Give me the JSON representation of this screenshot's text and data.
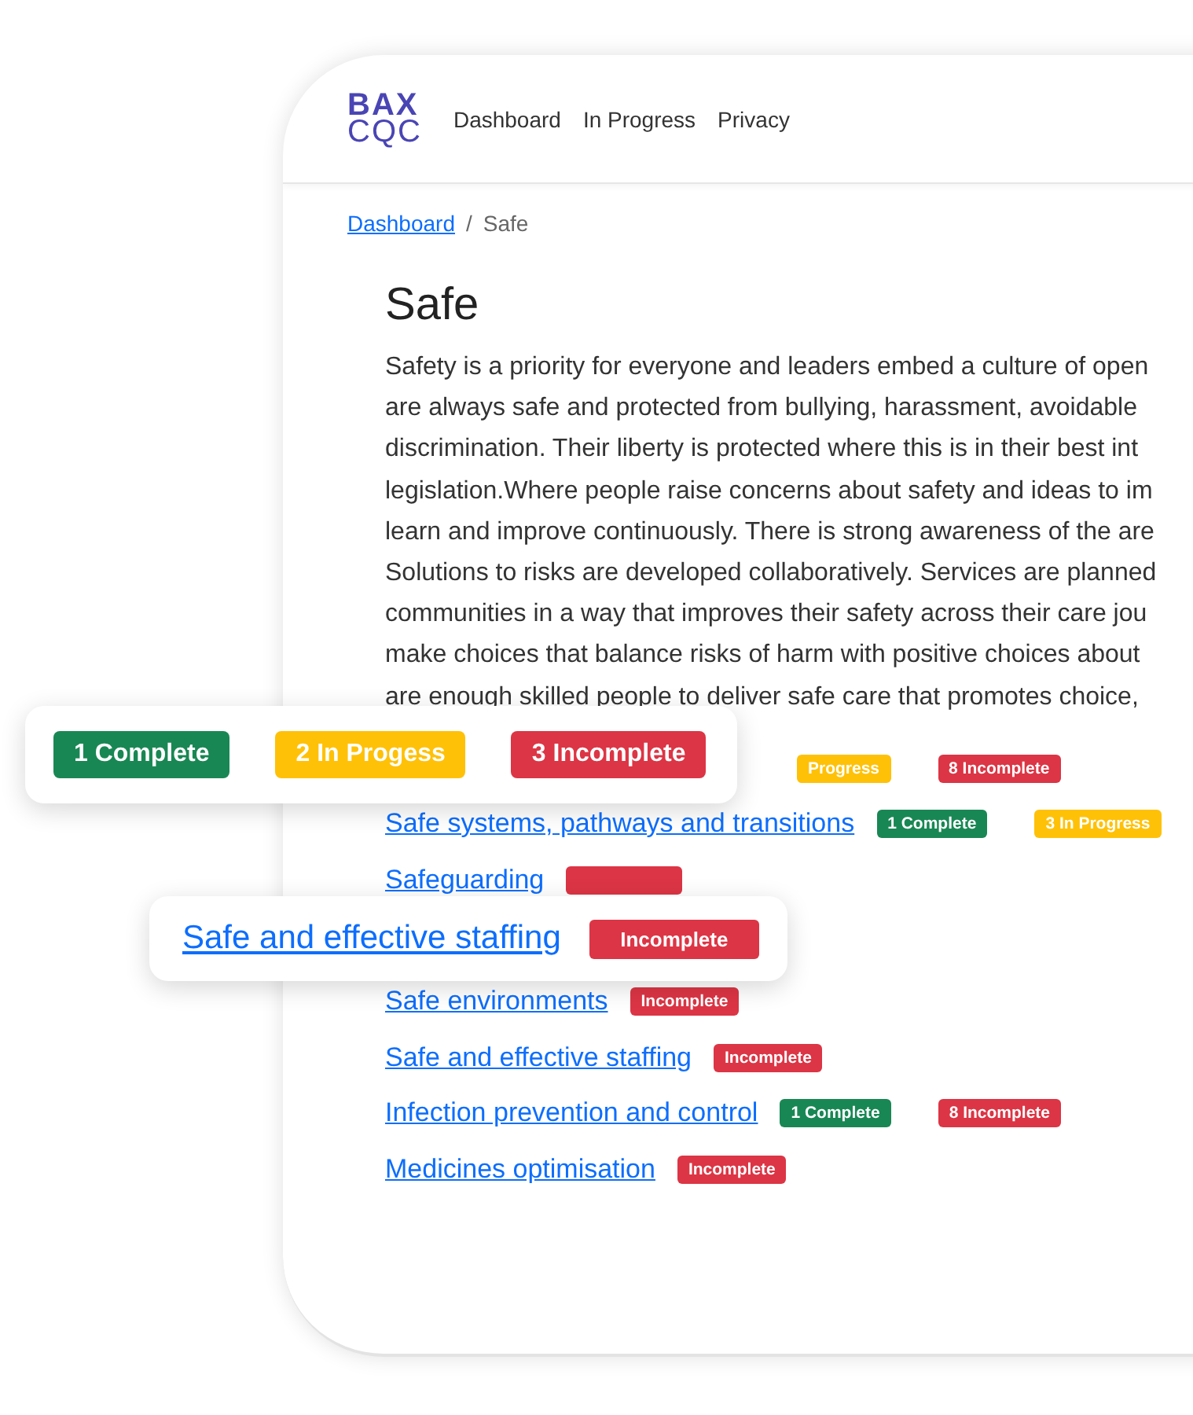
{
  "logo": {
    "top": "BAX",
    "bottom": "CQC"
  },
  "nav": [
    "Dashboard",
    "In Progress",
    "Privacy"
  ],
  "breadcrumb": {
    "link": "Dashboard",
    "separator": "/",
    "current": "Safe"
  },
  "heading": "Safe",
  "description_lines": [
    "Safety is a priority for everyone and leaders embed a culture of open",
    "are always safe and protected from bullying, harassment, avoidable",
    "discrimination. Their liberty is protected where this is in their best int",
    "legislation.Where people raise concerns about safety and ideas to im",
    "learn and improve continuously. There is strong awareness of the are",
    "Solutions to risks are developed collaboratively. Services are planned",
    "communities in a way that improves their safety across their care jou",
    "make choices that balance risks of harm with positive choices about",
    "are enough skilled people to deliver safe care that promotes choice,"
  ],
  "rows": [
    {
      "kind": "covered",
      "badges": [
        {
          "text": "Progress",
          "color": "#ffc107"
        },
        {
          "text": "8 Incomplete",
          "color": "#dc3545"
        }
      ]
    },
    {
      "kind": "link",
      "link": "Safe systems, pathways and transitions",
      "badges": [
        {
          "text": "1 Complete",
          "color": "#198754"
        },
        {
          "text": "3 In Progress",
          "color": "#ffc107"
        }
      ]
    },
    {
      "kind": "link",
      "link": "Safeguarding",
      "badges": [
        {
          "color": "#dc3545"
        }
      ]
    },
    {
      "kind": "hidden",
      "badges": []
    },
    {
      "kind": "link",
      "link": "Safe environments",
      "badges": [
        {
          "text": "Incomplete",
          "color": "#dc3545"
        }
      ]
    },
    {
      "kind": "link",
      "link": "Safe and effective staffing",
      "badges": [
        {
          "text": "Incomplete",
          "color": "#dc3545"
        }
      ]
    },
    {
      "kind": "link",
      "link": "Infection prevention and control",
      "badges": [
        {
          "text": "1 Complete",
          "color": "#198754"
        },
        {
          "text": "8 Incomplete",
          "color": "#dc3545"
        }
      ]
    },
    {
      "kind": "link",
      "link": "Medicines optimisation",
      "badges": [
        {
          "text": "Incomplete",
          "color": "#dc3545"
        }
      ]
    }
  ],
  "summary_card": {
    "badges": [
      {
        "text": "1 Complete",
        "color": "#198754"
      },
      {
        "text": "2 In Progess",
        "color": "#ffc107"
      },
      {
        "text": "3 Incomplete",
        "color": "#dc3545"
      }
    ]
  },
  "highlight_card": {
    "link": "Safe and effective staffing",
    "badge": {
      "text": "Incomplete",
      "color": "#dc3545"
    }
  }
}
